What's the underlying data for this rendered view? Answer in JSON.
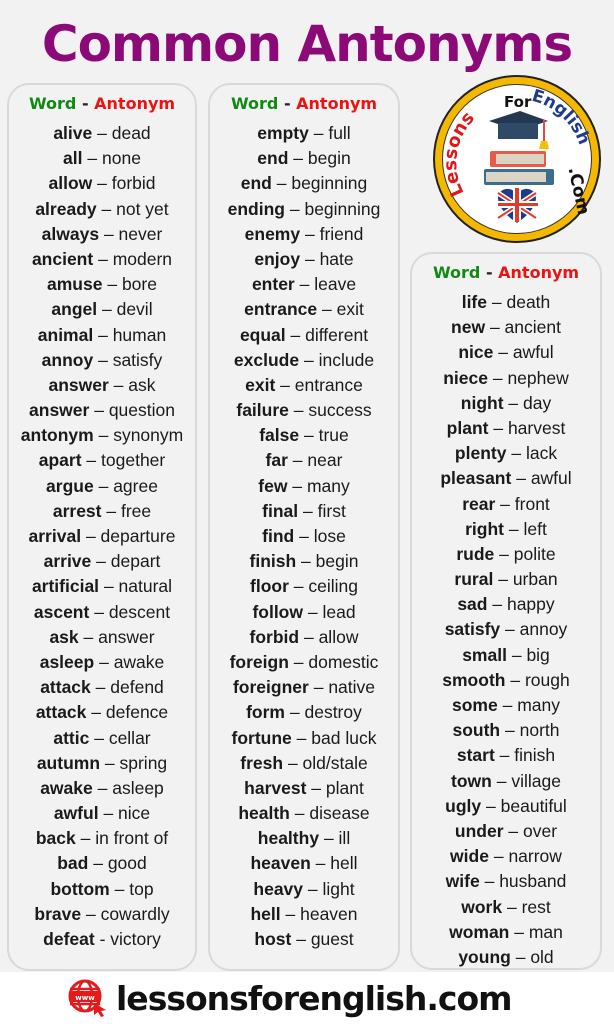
{
  "title": "Common Antonyms",
  "colors": {
    "title": "#8b0a78",
    "word_header": "#118a14",
    "antonym_header": "#ee1111",
    "text": "#1a1a1a",
    "brand_red": "#e51b1b"
  },
  "header": {
    "word": "Word",
    "separator": "-",
    "antonym": "Antonym"
  },
  "columns": [
    {
      "pairs": [
        {
          "word": "alive",
          "sep": "–",
          "antonym": "dead"
        },
        {
          "word": "all",
          "sep": "–",
          "antonym": "none"
        },
        {
          "word": "allow",
          "sep": "–",
          "antonym": "forbid"
        },
        {
          "word": "already",
          "sep": "–",
          "antonym": "not yet"
        },
        {
          "word": "always",
          "sep": "–",
          "antonym": "never"
        },
        {
          "word": "ancient",
          "sep": "–",
          "antonym": "modern"
        },
        {
          "word": "amuse",
          "sep": "–",
          "antonym": "bore"
        },
        {
          "word": "angel",
          "sep": "–",
          "antonym": "devil"
        },
        {
          "word": "animal",
          "sep": "–",
          "antonym": "human"
        },
        {
          "word": "annoy",
          "sep": "–",
          "antonym": "satisfy"
        },
        {
          "word": "answer",
          "sep": "–",
          "antonym": "ask"
        },
        {
          "word": "answer",
          "sep": "–",
          "antonym": "question"
        },
        {
          "word": "antonym",
          "sep": "–",
          "antonym": "synonym"
        },
        {
          "word": "apart",
          "sep": "–",
          "antonym": "together"
        },
        {
          "word": "argue",
          "sep": "–",
          "antonym": "agree"
        },
        {
          "word": "arrest",
          "sep": "–",
          "antonym": "free"
        },
        {
          "word": "arrival",
          "sep": "–",
          "antonym": "departure"
        },
        {
          "word": "arrive",
          "sep": "–",
          "antonym": "depart"
        },
        {
          "word": "artificial",
          "sep": "–",
          "antonym": "natural"
        },
        {
          "word": "ascent",
          "sep": "–",
          "antonym": "descent"
        },
        {
          "word": "ask",
          "sep": "–",
          "antonym": "answer"
        },
        {
          "word": "asleep",
          "sep": "–",
          "antonym": "awake"
        },
        {
          "word": "attack",
          "sep": "–",
          "antonym": "defend"
        },
        {
          "word": "attack",
          "sep": "–",
          "antonym": "defence"
        },
        {
          "word": "attic",
          "sep": "–",
          "antonym": "cellar"
        },
        {
          "word": "autumn",
          "sep": "–",
          "antonym": "spring"
        },
        {
          "word": "awake",
          "sep": "–",
          "antonym": "asleep"
        },
        {
          "word": "awful",
          "sep": "–",
          "antonym": "nice"
        },
        {
          "word": "back",
          "sep": "–",
          "antonym": "in front of"
        },
        {
          "word": "bad",
          "sep": "–",
          "antonym": "good"
        },
        {
          "word": "bottom",
          "sep": "–",
          "antonym": "top"
        },
        {
          "word": "brave",
          "sep": "–",
          "antonym": "cowardly"
        },
        {
          "word": "defeat",
          "sep": "-",
          "antonym": "victory"
        }
      ]
    },
    {
      "pairs": [
        {
          "word": "empty",
          "sep": "–",
          "antonym": "full"
        },
        {
          "word": "end",
          "sep": "–",
          "antonym": "begin"
        },
        {
          "word": "end",
          "sep": "–",
          "antonym": "beginning"
        },
        {
          "word": "ending",
          "sep": "–",
          "antonym": "beginning"
        },
        {
          "word": "enemy",
          "sep": "–",
          "antonym": "friend"
        },
        {
          "word": "enjoy",
          "sep": "–",
          "antonym": "hate"
        },
        {
          "word": "enter",
          "sep": "–",
          "antonym": "leave"
        },
        {
          "word": "entrance",
          "sep": "–",
          "antonym": "exit"
        },
        {
          "word": "equal",
          "sep": "–",
          "antonym": "different"
        },
        {
          "word": "exclude",
          "sep": "–",
          "antonym": "include"
        },
        {
          "word": "exit",
          "sep": "–",
          "antonym": "entrance"
        },
        {
          "word": "failure",
          "sep": "–",
          "antonym": "success"
        },
        {
          "word": "false",
          "sep": "–",
          "antonym": "true"
        },
        {
          "word": "far",
          "sep": "–",
          "antonym": "near"
        },
        {
          "word": "few",
          "sep": "–",
          "antonym": "many"
        },
        {
          "word": "final",
          "sep": "–",
          "antonym": "first"
        },
        {
          "word": "find",
          "sep": "–",
          "antonym": "lose"
        },
        {
          "word": "finish",
          "sep": "–",
          "antonym": "begin"
        },
        {
          "word": "floor",
          "sep": "–",
          "antonym": "ceiling"
        },
        {
          "word": "follow",
          "sep": "–",
          "antonym": "lead"
        },
        {
          "word": "forbid",
          "sep": "–",
          "antonym": "allow"
        },
        {
          "word": "foreign",
          "sep": "–",
          "antonym": "domestic"
        },
        {
          "word": "foreigner",
          "sep": "–",
          "antonym": "native"
        },
        {
          "word": "form",
          "sep": "–",
          "antonym": "destroy"
        },
        {
          "word": "fortune",
          "sep": "–",
          "antonym": "bad luck"
        },
        {
          "word": "fresh",
          "sep": "–",
          "antonym": "old/stale"
        },
        {
          "word": "harvest",
          "sep": "–",
          "antonym": "plant"
        },
        {
          "word": "health",
          "sep": "–",
          "antonym": "disease"
        },
        {
          "word": "healthy",
          "sep": "–",
          "antonym": "ill"
        },
        {
          "word": "heaven",
          "sep": "–",
          "antonym": "hell"
        },
        {
          "word": "heavy",
          "sep": "–",
          "antonym": "light"
        },
        {
          "word": "hell",
          "sep": "–",
          "antonym": "heaven"
        },
        {
          "word": "host",
          "sep": "–",
          "antonym": "guest"
        }
      ]
    },
    {
      "pairs": [
        {
          "word": "life",
          "sep": "–",
          "antonym": "death"
        },
        {
          "word": "new",
          "sep": "–",
          "antonym": "ancient"
        },
        {
          "word": "nice",
          "sep": "–",
          "antonym": "awful"
        },
        {
          "word": "niece",
          "sep": "–",
          "antonym": "nephew"
        },
        {
          "word": "night",
          "sep": "–",
          "antonym": "day"
        },
        {
          "word": "plant",
          "sep": "–",
          "antonym": "harvest"
        },
        {
          "word": "plenty",
          "sep": "–",
          "antonym": "lack"
        },
        {
          "word": "pleasant",
          "sep": "–",
          "antonym": "awful"
        },
        {
          "word": "rear",
          "sep": "–",
          "antonym": "front"
        },
        {
          "word": "right",
          "sep": "–",
          "antonym": "left"
        },
        {
          "word": "rude",
          "sep": "–",
          "antonym": "polite"
        },
        {
          "word": "rural",
          "sep": "–",
          "antonym": "urban"
        },
        {
          "word": "sad",
          "sep": "–",
          "antonym": "happy"
        },
        {
          "word": "satisfy",
          "sep": "–",
          "antonym": "annoy"
        },
        {
          "word": "small",
          "sep": "–",
          "antonym": "big"
        },
        {
          "word": "smooth",
          "sep": "–",
          "antonym": "rough"
        },
        {
          "word": "some",
          "sep": "–",
          "antonym": "many"
        },
        {
          "word": "south",
          "sep": "–",
          "antonym": "north"
        },
        {
          "word": "start",
          "sep": "–",
          "antonym": "finish"
        },
        {
          "word": "town",
          "sep": "–",
          "antonym": "village"
        },
        {
          "word": "ugly",
          "sep": "–",
          "antonym": "beautiful"
        },
        {
          "word": "under",
          "sep": "–",
          "antonym": "over"
        },
        {
          "word": "wide",
          "sep": "–",
          "antonym": "narrow"
        },
        {
          "word": "wife",
          "sep": "–",
          "antonym": "husband"
        },
        {
          "word": "work",
          "sep": "–",
          "antonym": "rest"
        },
        {
          "word": "woman",
          "sep": "–",
          "antonym": "man"
        },
        {
          "word": "young",
          "sep": "–",
          "antonym": "old"
        }
      ]
    }
  ],
  "logo": {
    "text_lessons": "Lessons",
    "text_for": "For",
    "text_english": "English",
    "text_com": ".Com",
    "icon": "graduation-cap-books-uk-heart-icon"
  },
  "footer": {
    "icon": "web-globe-cursor-icon",
    "site": "lessonsforenglish.com"
  }
}
